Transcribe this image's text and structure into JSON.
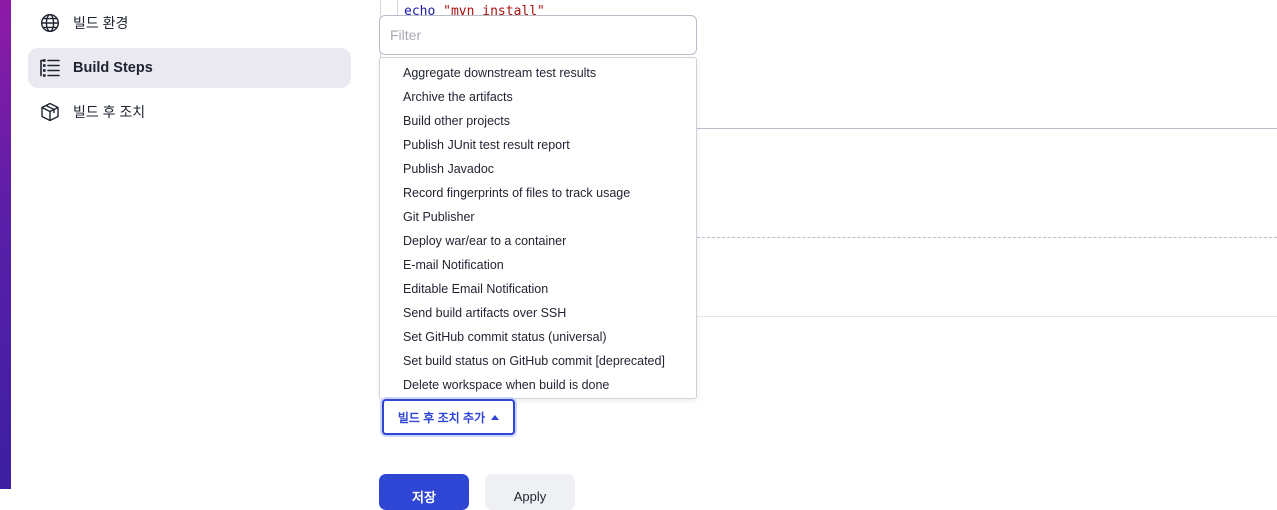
{
  "sidebar": {
    "items": [
      {
        "label": "빌드 환경",
        "icon": "globe-icon",
        "active": false
      },
      {
        "label": "Build Steps",
        "icon": "list-icon",
        "active": true
      },
      {
        "label": "빌드 후 조치",
        "icon": "package-icon",
        "active": false
      }
    ]
  },
  "code": {
    "keyword": "echo",
    "string": "\"mvn install\""
  },
  "filter": {
    "placeholder": "Filter"
  },
  "dropdown": {
    "items": [
      "Aggregate downstream test results",
      "Archive the artifacts",
      "Build other projects",
      "Publish JUnit test result report",
      "Publish Javadoc",
      "Record fingerprints of files to track usage",
      "Git Publisher",
      "Deploy war/ear to a container",
      "E-mail Notification",
      "Editable Email Notification",
      "Send build artifacts over SSH",
      "Set GitHub commit status (universal)",
      "Set build status on GitHub commit [deprecated]",
      "Delete workspace when build is done"
    ]
  },
  "actions": {
    "add_post_build_label": "빌드 후 조치 추가",
    "save_label": "저장",
    "apply_label": "Apply"
  },
  "colors": {
    "accent": "#2f45d4",
    "sidebar_active_bg": "#eae9f1"
  }
}
